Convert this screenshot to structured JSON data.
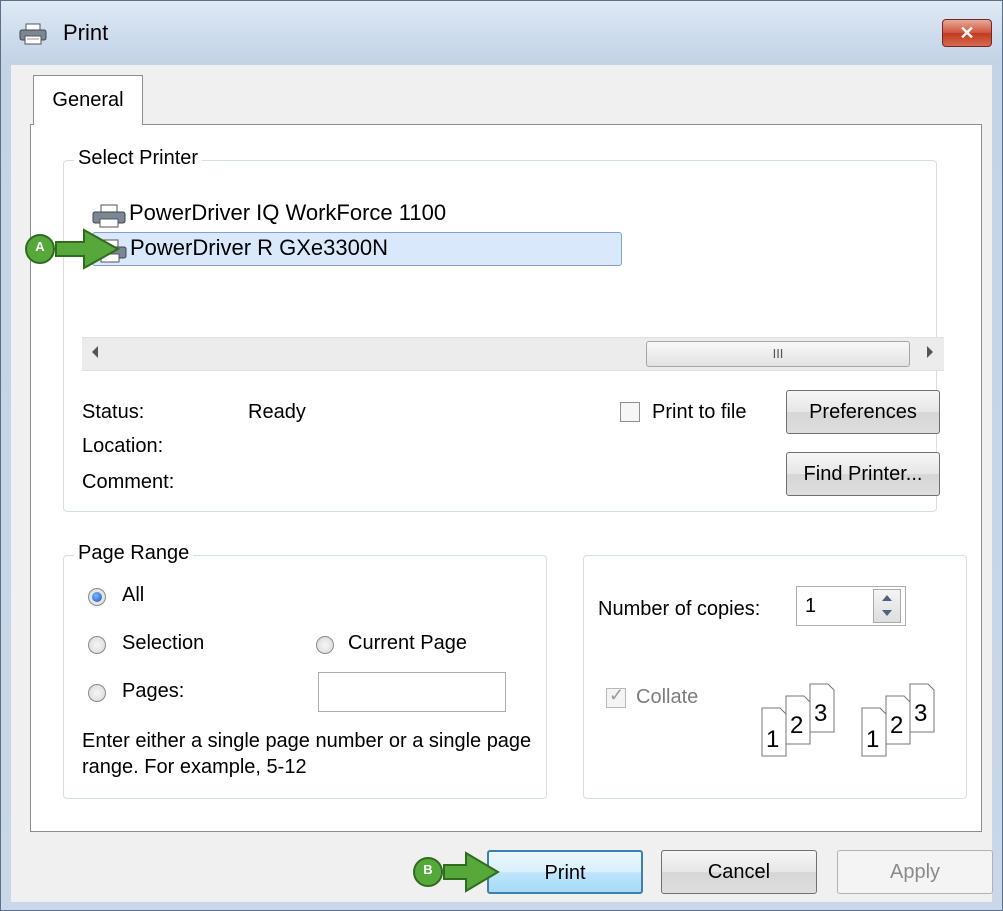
{
  "window": {
    "title": "Print",
    "close_label": "✕"
  },
  "tabs": [
    {
      "label": "General"
    }
  ],
  "select_printer": {
    "legend": "Select Printer",
    "printers": [
      {
        "name": "PowerDriver IQ WorkForce 1100",
        "selected": false
      },
      {
        "name": "PowerDriver R GXe3300N",
        "selected": true
      }
    ],
    "scroll_grip": "III",
    "status_label": "Status:",
    "status_value": "Ready",
    "location_label": "Location:",
    "comment_label": "Comment:",
    "print_to_file_label": "Print to file",
    "print_to_file_checked": false,
    "preferences_label": "Preferences",
    "find_printer_label": "Find Printer..."
  },
  "page_range": {
    "legend": "Page Range",
    "options": {
      "all": "All",
      "selection": "Selection",
      "current_page": "Current Page",
      "pages": "Pages:"
    },
    "selected": "all",
    "pages_value": "",
    "hint": "Enter either a single page number or a single page range.  For example, 5-12"
  },
  "copies": {
    "label": "Number of copies:",
    "value": "1",
    "collate_label": "Collate",
    "collate_checked": true,
    "collate_disabled": true,
    "page_numbers": [
      "1",
      "2",
      "3"
    ]
  },
  "footer": {
    "print_label": "Print",
    "cancel_label": "Cancel",
    "apply_label": "Apply"
  },
  "callouts": {
    "a": "A",
    "b": "B"
  },
  "colors": {
    "callout_green": "#56a83a",
    "selected_bg": "#d9e8fb",
    "selected_border": "#7da2ce",
    "print_border": "#3c7fb1"
  }
}
